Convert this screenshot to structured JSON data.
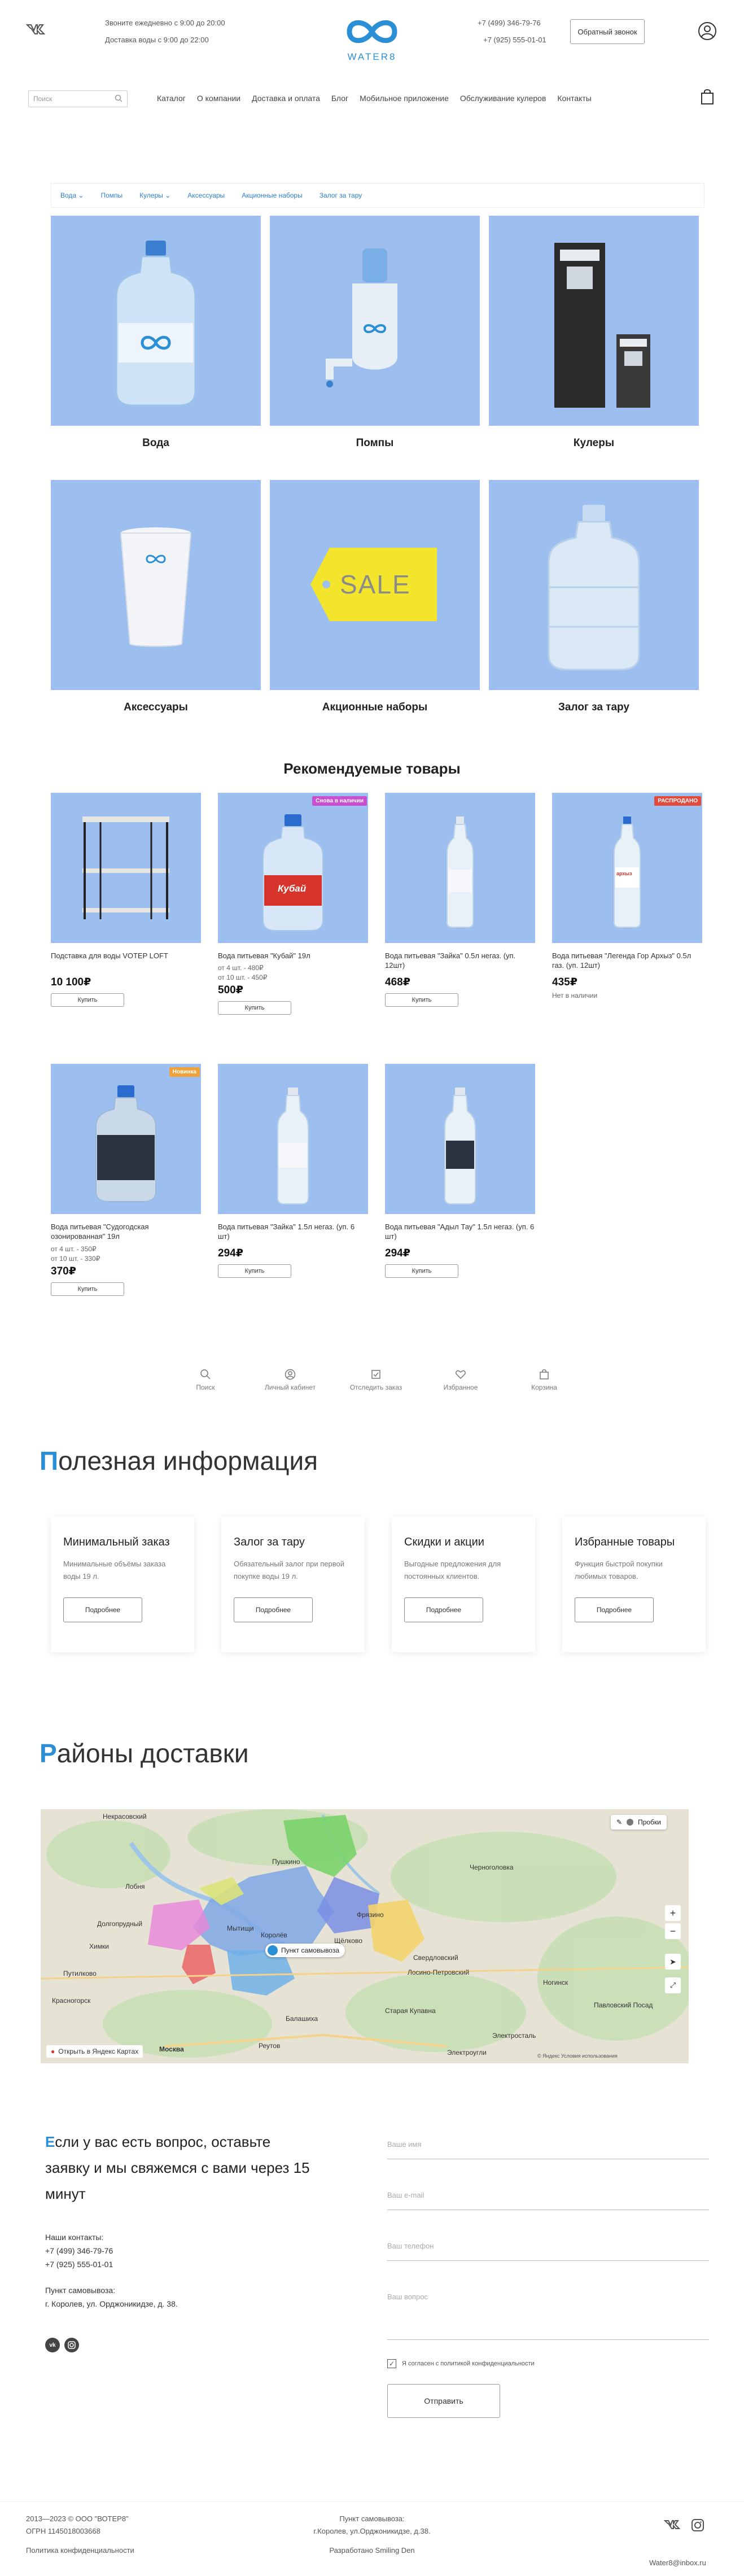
{
  "header": {
    "schedule_calls": "Звоните ежедневно с 9:00 до 20:00",
    "schedule_delivery": "Доставка воды с 9:00 до 22:00",
    "logo_text": "WATER8",
    "phone_1": "+7 (499) 346-79-76",
    "phone_2": "+7 (925) 555-01-01",
    "callback_label": "Обратный звонок"
  },
  "search": {
    "placeholder": "Поиск"
  },
  "nav": [
    {
      "label": "Каталог"
    },
    {
      "label": "О компании"
    },
    {
      "label": "Доставка и оплата"
    },
    {
      "label": "Блог"
    },
    {
      "label": "Мобильное приложение"
    },
    {
      "label": "Обслуживание кулеров"
    },
    {
      "label": "Контакты"
    }
  ],
  "subnav": [
    {
      "label": "Вода"
    },
    {
      "label": "Помпы"
    },
    {
      "label": "Кулеры"
    },
    {
      "label": "Аксессуары"
    },
    {
      "label": "Акционные наборы"
    },
    {
      "label": "Залог за тару"
    }
  ],
  "categories": [
    {
      "label": "Вода",
      "icon": "water-bottle-icon"
    },
    {
      "label": "Помпы",
      "icon": "pump-icon"
    },
    {
      "label": "Кулеры",
      "icon": "cooler-icon"
    },
    {
      "label": "Аксессуары",
      "icon": "cup-icon"
    },
    {
      "label": "Акционные наборы",
      "icon": "sale-tag-icon",
      "tag_text": "SALE"
    },
    {
      "label": "Залог за тару",
      "icon": "empty-bottle-icon"
    }
  ],
  "recommended": {
    "title": "Рекомендуемые товары",
    "buy_label": "Купить",
    "products": [
      {
        "name": "Подставка для воды VOTEP LOFT",
        "price": "10 100₽",
        "tiers": [],
        "buy": true,
        "badge": "",
        "badge_color": ""
      },
      {
        "name": "Вода питьевая \"Кубай\" 19л",
        "price": "500₽",
        "tiers": [
          "от 4 шт. - 480₽",
          "от 10 шт. - 450₽"
        ],
        "buy": true,
        "badge": "Снова в наличии",
        "badge_color": "#c94fd1",
        "bottle_label": "Кубай"
      },
      {
        "name": "Вода питьевая \"Зайка\" 0.5л негаз. (уп. 12шт)",
        "price": "468₽",
        "tiers": [],
        "buy": true,
        "badge": "",
        "badge_color": ""
      },
      {
        "name": "Вода питьевая \"Легенда Гор Архыз\" 0.5л газ. (уп. 12шт)",
        "price": "435₽",
        "tiers": [],
        "buy": false,
        "stock": "Нет в наличии",
        "badge": "РАСПРОДАНО",
        "badge_color": "#e24a3b",
        "bottle_label": "архыз"
      },
      {
        "name": "Вода питьевая \"Судогодская озонированная\" 19л",
        "price": "370₽",
        "tiers": [
          "от 4 шт. - 350₽",
          "от 10 шт. - 330₽"
        ],
        "buy": true,
        "badge": "Новинка",
        "badge_color": "#f0a23a"
      },
      {
        "name": "Вода питьевая \"Зайка\" 1.5л негаз. (уп. 6 шт)",
        "price": "294₽",
        "tiers": [],
        "buy": true,
        "badge": "",
        "badge_color": ""
      },
      {
        "name": "Вода питьевая \"Адыл Тау\" 1.5л негаз. (уп. 6 шт)",
        "price": "294₽",
        "tiers": [],
        "buy": true,
        "badge": "",
        "badge_color": ""
      }
    ]
  },
  "bottom_bar": [
    {
      "label": "Поиск",
      "icon": "search-icon"
    },
    {
      "label": "Личный кабинет",
      "icon": "user-icon"
    },
    {
      "label": "Отследить заказ",
      "icon": "track-order-icon"
    },
    {
      "label": "Избранное",
      "icon": "heart-icon"
    },
    {
      "label": "Корзина",
      "icon": "cart-icon"
    }
  ],
  "useful": {
    "title_first": "П",
    "title_rest": "олезная информация",
    "more_label": "Подробнее",
    "cards": [
      {
        "title": "Минимальный заказ",
        "text": "Минимальные объёмы заказа воды 19 л."
      },
      {
        "title": "Залог за тару",
        "text": "Обязательный залог при первой покупке воды 19 л."
      },
      {
        "title": "Скидки и акции",
        "text": "Выгодные предложения для постоянных клиентов."
      },
      {
        "title": "Избранные товары",
        "text": "Функция быстрой покупки любимых товаров."
      }
    ]
  },
  "delivery": {
    "title_first": "Р",
    "title_rest": "айоны доставки",
    "traffic_label": "Пробки",
    "pickup_label": "Пункт самовывоза",
    "open_yandex": "Открыть в Яндекс Картах",
    "map_towns": [
      "Некрасовский",
      "Пушкино",
      "Лобня",
      "Долгопрудный",
      "Химки",
      "Мытищи",
      "Королёв",
      "Щёлково",
      "Фрязино",
      "Черноголовка",
      "Свердловский",
      "Лосино-Петровский",
      "Ногинск",
      "Балашиха",
      "Реутов",
      "Старая Купавна",
      "Электросталь",
      "Павловский Посад",
      "Москва",
      "Красногорск",
      "Путилково",
      "Электроугли"
    ],
    "map_copyright": "© Яндекс  Условия использования"
  },
  "contact": {
    "heading_first": "Е",
    "heading_rest": "сли у вас есть вопрос, оставьте заявку и мы свяжемся с вами через 15 минут",
    "our_contacts": "Наши контакты:",
    "phone_1": "+7 (499) 346-79-76",
    "phone_2": "+7 (925) 555-01-01",
    "pickup_title": "Пункт самовывоза:",
    "pickup_address": "г. Королев, ул. Орджоникидзе, д. 38.",
    "form": {
      "name": "Ваше имя",
      "email": "Ваш e-mail",
      "phone": "Ваш телефон",
      "question": "Ваш вопрос",
      "consent": "Я согласен с политикой конфиденциальности",
      "submit": "Отправить"
    }
  },
  "footer": {
    "copyright": "2013—2023 © ООО \"ВОТЕР8\"",
    "ogrn": "ОГРН 1145018003668",
    "policy": "Политика конфиденциальности",
    "pickup_title": "Пункт самовывоза:",
    "pickup_address": "г.Королев, ул.Орджоникидзе, д.38.",
    "developer": "Разработано Smiling Den",
    "email": "Water8@inbox.ru"
  },
  "colors": {
    "accent": "#2b8fd6",
    "tile_bg": "#9dbff0"
  }
}
